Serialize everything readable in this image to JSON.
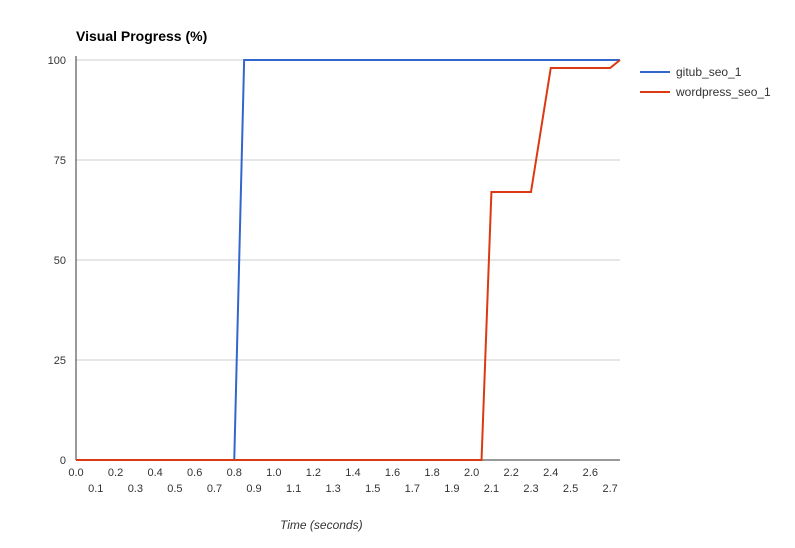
{
  "chart_data": {
    "type": "line",
    "title": "Visual Progress (%)",
    "xlabel": "Time (seconds)",
    "ylabel": "",
    "x_ticks": [
      0.0,
      0.1,
      0.2,
      0.3,
      0.4,
      0.5,
      0.6,
      0.7,
      0.8,
      0.9,
      1.0,
      1.1,
      1.2,
      1.3,
      1.4,
      1.5,
      1.6,
      1.7,
      1.8,
      1.9,
      2.0,
      2.1,
      2.2,
      2.3,
      2.4,
      2.5,
      2.6,
      2.7
    ],
    "y_ticks": [
      0,
      25,
      50,
      75,
      100
    ],
    "xlim": [
      0.0,
      2.75
    ],
    "ylim": [
      0,
      100
    ],
    "series": [
      {
        "name": "gitub_seo_1",
        "color": "#3366cc",
        "x": [
          0.0,
          0.1,
          0.2,
          0.3,
          0.4,
          0.5,
          0.6,
          0.7,
          0.8,
          0.85,
          0.9,
          1.0,
          1.1,
          1.2,
          1.3,
          1.4,
          1.5,
          1.6,
          1.7,
          1.8,
          1.9,
          2.0,
          2.1,
          2.2,
          2.3,
          2.4,
          2.5,
          2.6,
          2.7,
          2.75
        ],
        "y": [
          0,
          0,
          0,
          0,
          0,
          0,
          0,
          0,
          0,
          100,
          100,
          100,
          100,
          100,
          100,
          100,
          100,
          100,
          100,
          100,
          100,
          100,
          100,
          100,
          100,
          100,
          100,
          100,
          100,
          100
        ]
      },
      {
        "name": "wordpress_seo_1",
        "color": "#dc3912",
        "x": [
          0.0,
          0.1,
          0.2,
          0.3,
          0.4,
          0.5,
          0.6,
          0.7,
          0.8,
          0.9,
          1.0,
          1.1,
          1.2,
          1.3,
          1.4,
          1.5,
          1.6,
          1.7,
          1.8,
          1.9,
          2.0,
          2.05,
          2.1,
          2.2,
          2.3,
          2.4,
          2.5,
          2.6,
          2.7,
          2.75
        ],
        "y": [
          0,
          0,
          0,
          0,
          0,
          0,
          0,
          0,
          0,
          0,
          0,
          0,
          0,
          0,
          0,
          0,
          0,
          0,
          0,
          0,
          0,
          0,
          67,
          67,
          67,
          98,
          98,
          98,
          98,
          100
        ]
      }
    ],
    "legend_position": "right"
  }
}
